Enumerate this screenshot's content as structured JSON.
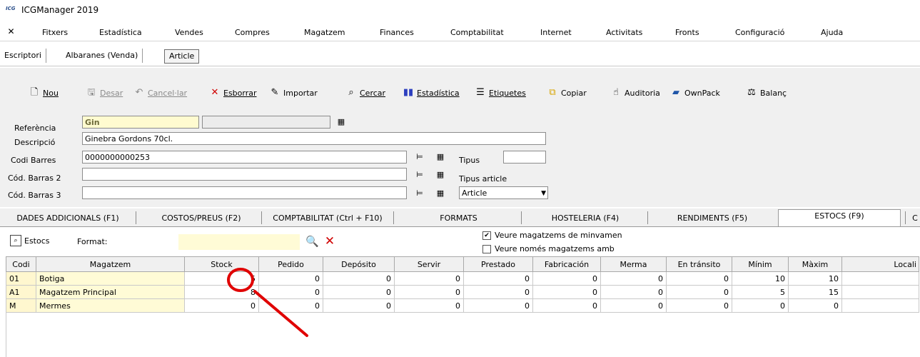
{
  "window": {
    "title": "ICGManager 2019",
    "logo_text": "ICG"
  },
  "menu": [
    "Fitxers",
    "Estadística",
    "Vendes",
    "Compres",
    "Magatzem",
    "Finances",
    "Comptabilitat",
    "Internet",
    "Activitats",
    "Fronts",
    "Configuració",
    "Ajuda"
  ],
  "doc_tabs": [
    "Escriptori",
    "Albaranes (Venda)",
    "Article"
  ],
  "toolbar": {
    "nou": "Nou",
    "desar": "Desar",
    "cancelar": "Cancel·lar",
    "esborrar": "Esborrar",
    "importar": "Importar",
    "cercar": "Cercar",
    "estadistica": "Estadística",
    "etiquetes": "Etiquetes",
    "copiar": "Copiar",
    "auditoria": "Auditoria",
    "ownpack": "OwnPack",
    "balanc": "Balanç"
  },
  "form": {
    "referencia_label": "Referència",
    "referencia_value": "Gin",
    "descripcio_label": "Descripció",
    "descripcio_value": "Ginebra Gordons 70cl.",
    "codi_barres_label": "Codi Barres",
    "codi_barres_value": "0000000000253",
    "cod_barras2_label": "Cód. Barras 2",
    "cod_barras2_value": "",
    "cod_barras3_label": "Cód. Barras 3",
    "cod_barras3_value": "",
    "tipus_label": "Tipus",
    "tipus_value": "",
    "tipus_article_label": "Tipus article",
    "tipus_article_value": "Article"
  },
  "section_tabs": [
    "DADES ADDICIONALS (F1)",
    "COSTOS/PREUS (F2)",
    "COMPTABILITAT (Ctrl + F10)",
    "FORMATS",
    "HOSTELERIA (F4)",
    "RENDIMENTS (F5)",
    "ESTOCS (F9)",
    "C"
  ],
  "stock": {
    "estocs_label": "Estocs",
    "format_label": "Format:",
    "format_value": "",
    "check1_label": "Veure magatzems de minvamen",
    "check1_checked": true,
    "check2_label": "Veure només magatzems amb",
    "check2_checked": false,
    "columns": [
      "Codi",
      "Magatzem",
      "Stock",
      "Pedido",
      "Depósito",
      "Servir",
      "Prestado",
      "Fabricación",
      "Merma",
      "En tránsito",
      "Mínim",
      "Màxim",
      "Locali"
    ],
    "rows": [
      [
        "01",
        "Botiga",
        "5",
        "0",
        "0",
        "0",
        "0",
        "0",
        "0",
        "0",
        "10",
        "10",
        ""
      ],
      [
        "A1",
        "Magatzem Principal",
        "8",
        "0",
        "0",
        "0",
        "0",
        "0",
        "0",
        "0",
        "5",
        "15",
        ""
      ],
      [
        "M",
        "Mermes",
        "0",
        "0",
        "0",
        "0",
        "0",
        "0",
        "0",
        "0",
        "0",
        "0",
        ""
      ]
    ]
  },
  "colors": {
    "annotation": "#e00000",
    "highlight_yellow": "#fff7cf"
  }
}
